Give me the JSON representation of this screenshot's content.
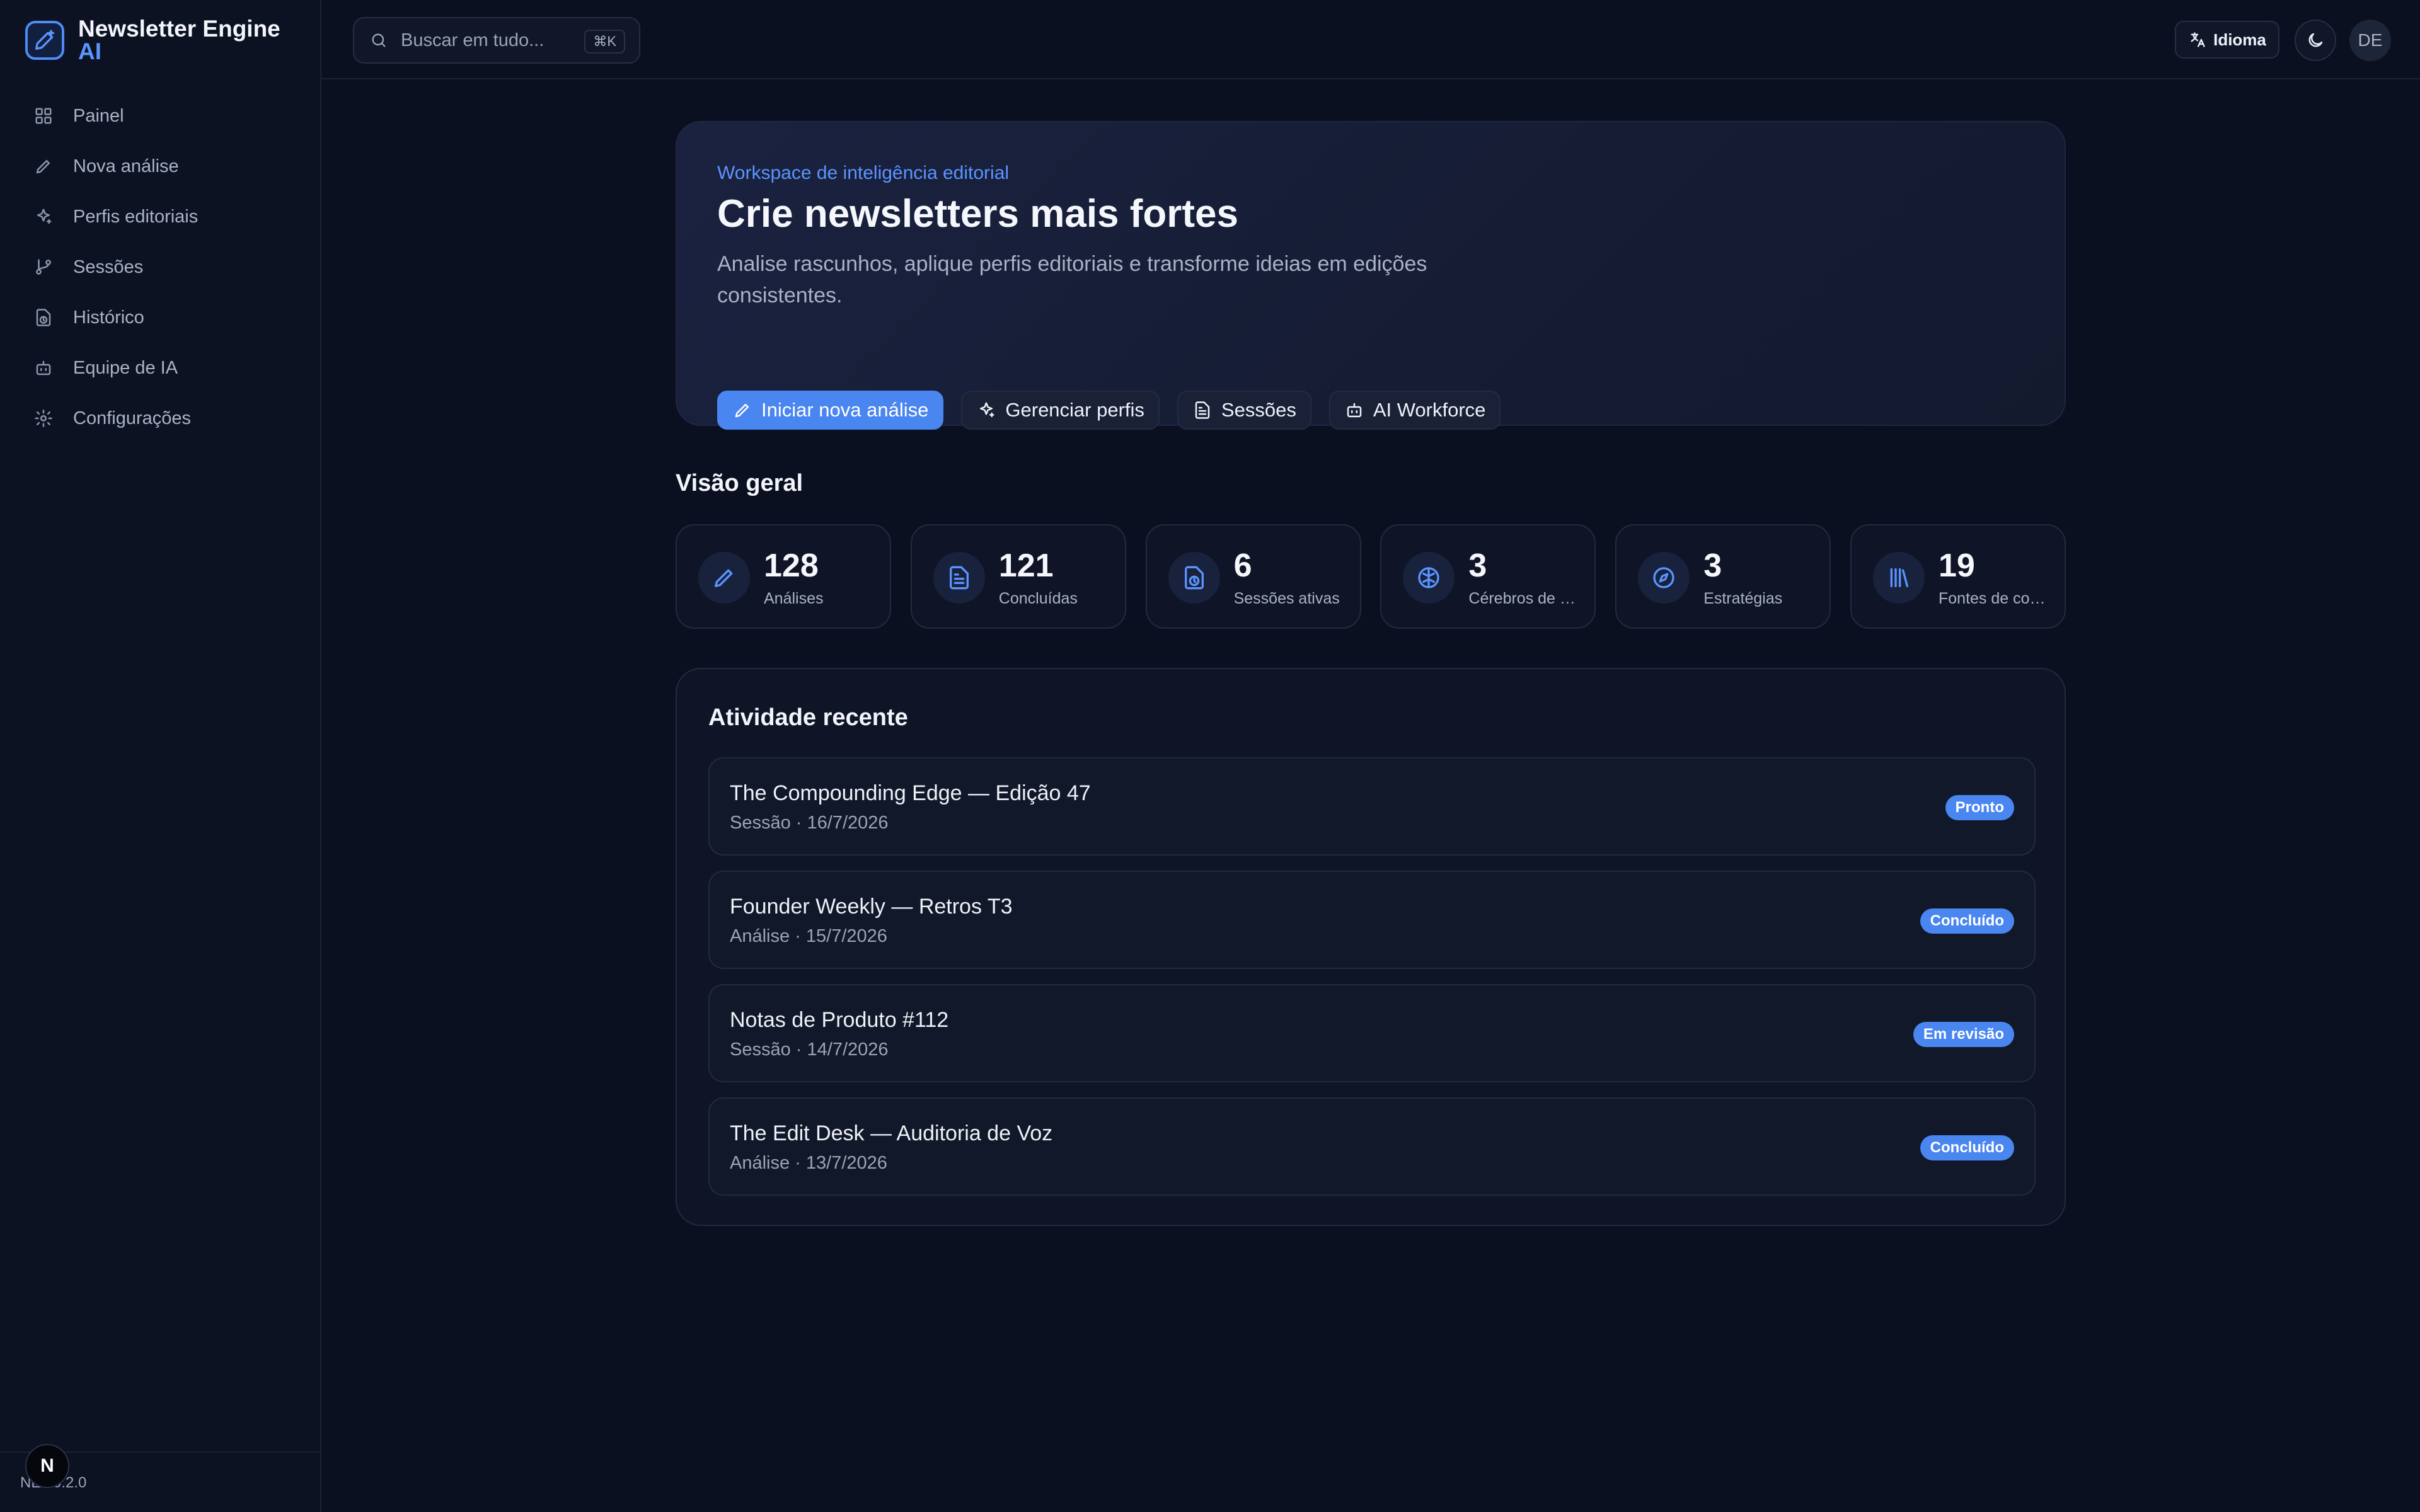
{
  "app": {
    "name": "Newsletter Engine",
    "name_suffix": "AI",
    "version": "NE v0.2.0"
  },
  "search": {
    "placeholder": "Buscar em tudo...",
    "shortcut": "⌘K"
  },
  "topbar": {
    "language_label": "Idioma",
    "avatar_initials": "DE"
  },
  "sidebar": {
    "items": [
      {
        "label": "Painel",
        "icon": "dashboard-icon"
      },
      {
        "label": "Nova análise",
        "icon": "pen-icon"
      },
      {
        "label": "Perfis editoriais",
        "icon": "sparkles-icon"
      },
      {
        "label": "Sessões",
        "icon": "git-branch-icon"
      },
      {
        "label": "Histórico",
        "icon": "file-clock-icon"
      },
      {
        "label": "Equipe de IA",
        "icon": "bot-icon"
      },
      {
        "label": "Configurações",
        "icon": "gear-icon"
      }
    ]
  },
  "hero": {
    "eyebrow": "Workspace de inteligência editorial",
    "title": "Crie newsletters mais fortes",
    "description": "Analise rascunhos, aplique perfis editoriais e transforme ideias em edições consistentes.",
    "actions": [
      {
        "label": "Iniciar nova análise",
        "icon": "pen-icon"
      },
      {
        "label": "Gerenciar perfis",
        "icon": "sparkles-icon"
      },
      {
        "label": "Sessões",
        "icon": "document-icon"
      },
      {
        "label": "AI Workforce",
        "icon": "bot-icon"
      }
    ]
  },
  "overview": {
    "title": "Visão geral",
    "stats": [
      {
        "value": "128",
        "label": "Análises",
        "icon": "pen-icon"
      },
      {
        "value": "121",
        "label": "Concluídas",
        "icon": "document-icon"
      },
      {
        "value": "6",
        "label": "Sessões ativas",
        "icon": "file-clock-icon"
      },
      {
        "value": "3",
        "label": "Cérebros de voz",
        "icon": "brain-icon"
      },
      {
        "value": "3",
        "label": "Estratégias",
        "icon": "compass-icon"
      },
      {
        "value": "19",
        "label": "Fontes de conteúdo",
        "icon": "library-icon"
      }
    ]
  },
  "activity": {
    "title": "Atividade recente",
    "items": [
      {
        "title": "The Compounding Edge — Edição 47",
        "type": "Sessão",
        "date": "16/7/2026",
        "status": "Pronto"
      },
      {
        "title": "Founder Weekly — Retros T3",
        "type": "Análise",
        "date": "15/7/2026",
        "status": "Concluído"
      },
      {
        "title": "Notas de Produto #112",
        "type": "Sessão",
        "date": "14/7/2026",
        "status": "Em revisão"
      },
      {
        "title": "The Edit Desk — Auditoria de Voz",
        "type": "Análise",
        "date": "13/7/2026",
        "status": "Concluído"
      }
    ]
  },
  "colors": {
    "accent": "#4a86f0",
    "background": "#0b1020",
    "card": "#0f1526"
  }
}
